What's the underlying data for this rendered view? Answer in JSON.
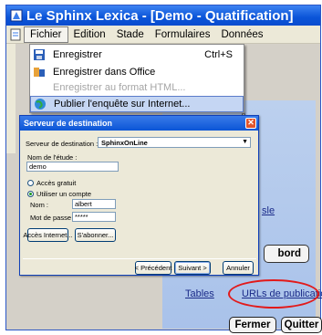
{
  "app": {
    "title": "Le Sphinx Lexica - [Demo - Quatification]",
    "menus": [
      "Fichier",
      "Edition",
      "Stade",
      "Formulaires",
      "Données"
    ]
  },
  "file_menu": {
    "items": [
      {
        "label": "Enregistrer",
        "shortcut": "Ctrl+S",
        "state": "normal"
      },
      {
        "label": "Enregistrer dans Office",
        "shortcut": "",
        "state": "normal"
      },
      {
        "label": "Enregistrer au format HTML...",
        "shortcut": "",
        "state": "disabled"
      },
      {
        "label": "Publier l'enquête sur Internet...",
        "shortcut": "",
        "state": "highlighted"
      }
    ]
  },
  "dialog": {
    "title": "Serveur de destination",
    "close_glyph": "✕",
    "server_label": "Serveur de destination :",
    "server_value": "SphinxOnLine",
    "study_label": "Nom de l'étude :",
    "study_value": "demo",
    "radio_free": "Accès gratuit",
    "radio_account": "Utiliser un compte",
    "name_label": "Nom :",
    "name_value": "albert",
    "password_label": "Mot de passe :",
    "password_value": "*****",
    "btn_internet": "Accès Internet...",
    "btn_subscribe": "S'abonner...",
    "btn_prev": "< Précédent",
    "btn_next": "Suivant >",
    "btn_cancel": "Annuler"
  },
  "background": {
    "partial_link": "sle",
    "partial_button": "bord",
    "link_tables": "Tables",
    "link_urls": "URLs de publication",
    "btn_close": "Fermer",
    "btn_quit": "Quitter"
  },
  "colors": {
    "titlebar": "#0a54d8",
    "menu_highlight": "#c5d6f3",
    "annotation": "#e21a1a",
    "backdrop": "#b5cbed"
  }
}
